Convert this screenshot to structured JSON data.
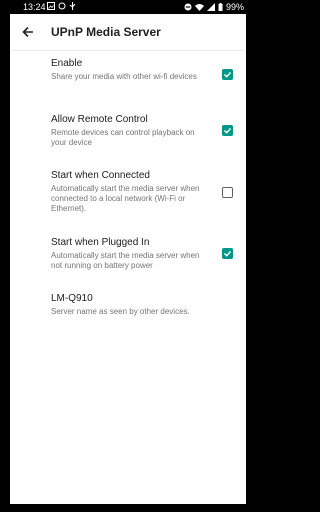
{
  "status": {
    "time": "13:24",
    "battery": "99%",
    "icons_left": [
      "image-icon",
      "sync-icon",
      "usb-icon"
    ],
    "icons_right": [
      "do-not-disturb-icon",
      "wifi-icon",
      "signal-icon",
      "battery-icon"
    ]
  },
  "appbar": {
    "back_icon": "arrow-back-icon",
    "title": "UPnP Media Server"
  },
  "prefs": [
    {
      "title": "Enable",
      "summary": "Share your media with other wi-fi devices",
      "checked": true
    },
    {
      "title": "Allow Remote Control",
      "summary": "Remote devices can control playback on your device",
      "checked": true
    },
    {
      "title": "Start when Connected",
      "summary": "Automatically start the media server when connected to a local network (Wi-Fi or Ethernet).",
      "checked": false
    },
    {
      "title": "Start when Plugged In",
      "summary": "Automatically start the media server when not running on battery power",
      "checked": true
    },
    {
      "title": "LM-Q910",
      "summary": "Server name as seen by other devices.",
      "checked": null
    }
  ],
  "colors": {
    "accent": "#009688",
    "title_text": "#212121",
    "summary_text": "#757575"
  }
}
